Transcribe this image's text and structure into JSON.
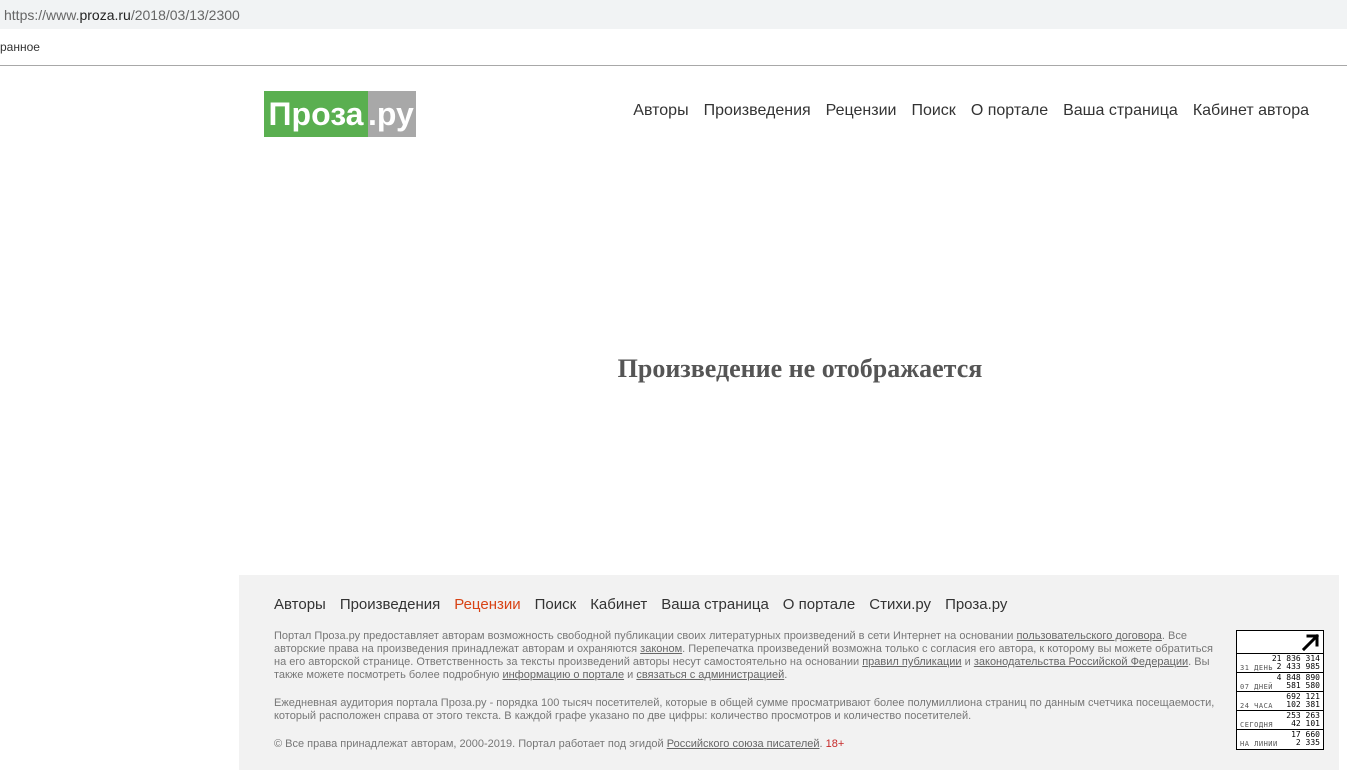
{
  "browser": {
    "url_prefix": "https://www.",
    "url_domain": "proza.ru",
    "url_path": "/2018/03/13/2300",
    "bookmark": "ранное"
  },
  "header": {
    "logo_main": "Проза",
    "logo_tld": ".ру",
    "nav": [
      "Авторы",
      "Произведения",
      "Рецензии",
      "Поиск",
      "О портале",
      "Ваша страница",
      "Кабинет автора"
    ]
  },
  "main": {
    "message": "Произведение не отображается"
  },
  "footer": {
    "nav": [
      "Авторы",
      "Произведения",
      "Рецензии",
      "Поиск",
      "Кабинет",
      "Ваша страница",
      "О портале",
      "Стихи.ру",
      "Проза.ру"
    ],
    "p1": {
      "t1": "Портал Проза.ру предоставляет авторам возможность свободной публикации своих литературных произведений в сети Интернет на основании ",
      "l1": "пользовательского договора",
      "t2": ". Все авторские права на произведения принадлежат авторам и охраняются ",
      "l2": "законом",
      "t3": ". Перепечатка произведений возможна только с согласия его автора, к которому вы можете обратиться на его авторской странице. Ответственность за тексты произведений авторы несут самостоятельно на основании ",
      "l3": "правил публикации",
      "t4": " и ",
      "l4": "законодательства Российской Федерации",
      "t5": ". Вы также можете посмотреть более подробную ",
      "l5": "информацию о портале",
      "t6": " и ",
      "l6": "связаться с администрацией",
      "t7": "."
    },
    "p2": "Ежедневная аудитория портала Проза.ру - порядка 100 тысяч посетителей, которые в общей сумме просматривают более полумиллиона страниц по данным счетчика посещаемости, который расположен справа от этого текста. В каждой графе указано по две цифры: количество просмотров и количество посетителей.",
    "p3": {
      "t1": "© Все права принадлежат авторам, 2000-2019.   Портал работает под эгидой ",
      "l1": "Российского союза писателей",
      "t2": ". ",
      "age": "18+"
    }
  },
  "counter": {
    "rows": [
      {
        "label": "31 ДЕНЬ",
        "v1": "21 836 314",
        "v2": "2 433 985"
      },
      {
        "label": "07 ДНЕЙ",
        "v1": "4 848 890",
        "v2": "581 580"
      },
      {
        "label": "24 ЧАСА",
        "v1": "692 121",
        "v2": "102 381"
      },
      {
        "label": "СЕГОДНЯ",
        "v1": "253 263",
        "v2": "42 101"
      },
      {
        "label": "НА ЛИНИИ",
        "v1": "17 660",
        "v2": "2 335"
      }
    ]
  }
}
